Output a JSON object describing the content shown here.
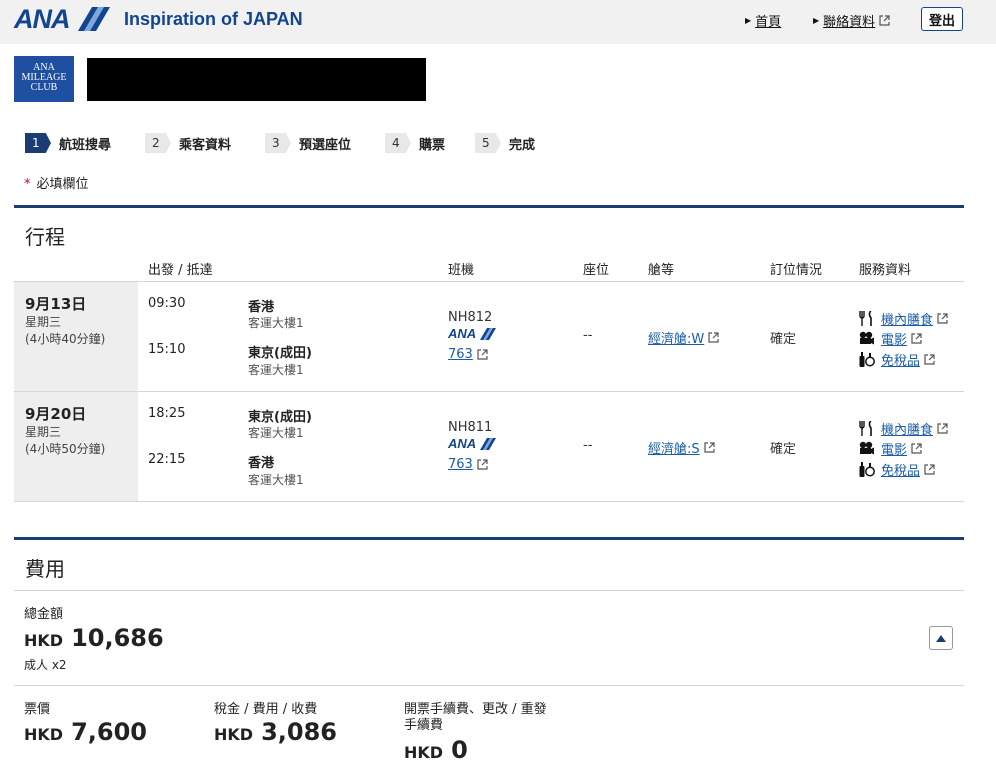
{
  "header": {
    "logo_text": "ANA",
    "tagline": "Inspiration of JAPAN",
    "home_link": "首頁",
    "contact_link": "聯絡資料",
    "logout_button": "登出"
  },
  "member": {
    "club_logo_lines": [
      "ANA",
      "MILEAGE",
      "CLUB"
    ]
  },
  "steps": [
    {
      "num": "1",
      "label": "航班搜尋",
      "active": true
    },
    {
      "num": "2",
      "label": "乘客資料",
      "active": false
    },
    {
      "num": "3",
      "label": "預選座位",
      "active": false
    },
    {
      "num": "4",
      "label": "購票",
      "active": false
    },
    {
      "num": "5",
      "label": "完成",
      "active": false
    }
  ],
  "required_note": {
    "star": "*",
    "text": "必填欄位"
  },
  "itinerary": {
    "title": "行程",
    "columns": [
      "出發 / 抵達",
      "班機",
      "座位",
      "艙等",
      "訂位情況",
      "服務資料"
    ],
    "flights": [
      {
        "date": "9月13日",
        "weekday": "星期三",
        "duration": "(4小時40分鐘)",
        "dep_time": "09:30",
        "dep_city": "香港",
        "dep_terminal": "客運大樓1",
        "arr_time": "15:10",
        "arr_city": "東京(成田)",
        "arr_terminal": "客運大樓1",
        "flight_no": "NH812",
        "airline_logo": "ANA",
        "aircraft": "763",
        "seat": "--",
        "cabin": "經濟艙:W",
        "status": "確定",
        "services": [
          "機內膳食",
          "電影",
          "免稅品"
        ]
      },
      {
        "date": "9月20日",
        "weekday": "星期三",
        "duration": "(4小時50分鐘)",
        "dep_time": "18:25",
        "dep_city": "東京(成田)",
        "dep_terminal": "客運大樓1",
        "arr_time": "22:15",
        "arr_city": "香港",
        "arr_terminal": "客運大樓1",
        "flight_no": "NH811",
        "airline_logo": "ANA",
        "aircraft": "763",
        "seat": "--",
        "cabin": "經濟艙:S",
        "status": "確定",
        "services": [
          "機內膳食",
          "電影",
          "免稅品"
        ]
      }
    ]
  },
  "fees": {
    "title": "費用",
    "total_label": "總金額",
    "total_currency": "HKD",
    "total_amount": "10,686",
    "passengers": "成人 x2",
    "fare_label": "票價",
    "fare_currency": "HKD",
    "fare_amount": "7,600",
    "tax_label": "稅金 / 費用 / 收費",
    "tax_currency": "HKD",
    "tax_amount": "3,086",
    "ticketing_label_line1": "開票手續費、更改 / 重發",
    "ticketing_label_line2": "手續費",
    "ticketing_currency": "HKD",
    "ticketing_amount": "0"
  },
  "colors": {
    "brand_blue": "#13448f",
    "navy": "#1b3d73",
    "link": "#1a5ca8",
    "required_red": "#d0021b"
  }
}
